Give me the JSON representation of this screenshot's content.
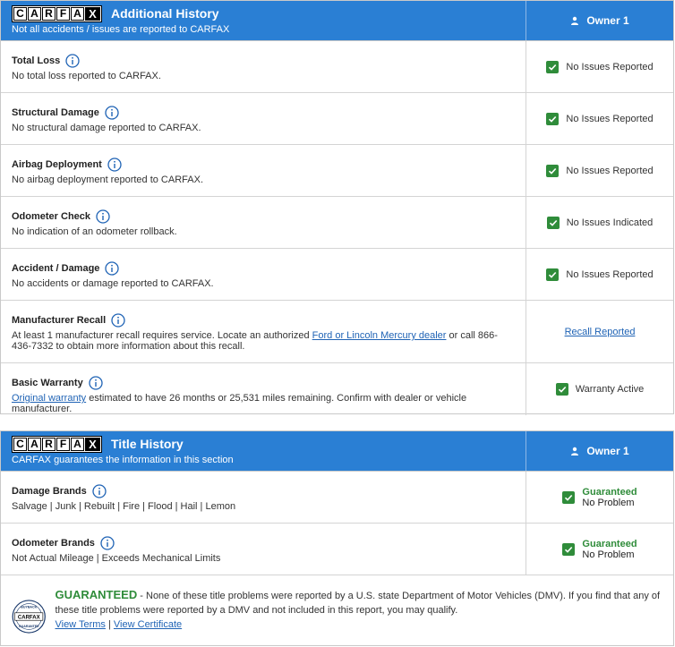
{
  "colors": {
    "header_bg": "#2a7fd4",
    "check_green": "#2f8c3a",
    "link_blue": "#1f63b5"
  },
  "logo_letters": [
    "C",
    "A",
    "R",
    "F",
    "A",
    "X"
  ],
  "additional_history": {
    "title": "Additional History",
    "subtitle": "Not all accidents / issues are reported to CARFAX",
    "owner_label": "Owner 1",
    "rows": [
      {
        "title": "Total Loss",
        "desc": "No total loss reported to CARFAX.",
        "status": "No Issues Reported"
      },
      {
        "title": "Structural Damage",
        "desc": "No structural damage reported to CARFAX.",
        "status": "No Issues Reported"
      },
      {
        "title": "Airbag Deployment",
        "desc": "No airbag deployment reported to CARFAX.",
        "status": "No Issues Reported"
      },
      {
        "title": "Odometer Check",
        "desc": "No indication of an odometer rollback.",
        "status": "No Issues Indicated"
      },
      {
        "title": "Accident / Damage",
        "desc": "No accidents or damage reported to CARFAX.",
        "status": "No Issues Reported"
      }
    ],
    "recall": {
      "title": "Manufacturer Recall",
      "desc_before": "At least 1 manufacturer recall requires service. Locate an authorized ",
      "desc_link": "Ford or Lincoln Mercury dealer",
      "desc_after": " or call 866-436-7332 to obtain more information about this recall.",
      "status_link": "Recall Reported"
    },
    "warranty": {
      "title": "Basic Warranty",
      "desc_link": "Original warranty",
      "desc_after": " estimated to have 26 months or 25,531 miles remaining. Confirm with dealer or vehicle manufacturer.",
      "status": "Warranty Active"
    }
  },
  "title_history": {
    "title": "Title History",
    "subtitle": "CARFAX guarantees the information in this section",
    "owner_label": "Owner 1",
    "rows": [
      {
        "title": "Damage Brands",
        "desc": "Salvage | Junk | Rebuilt | Fire | Flood | Hail | Lemon",
        "status_top": "Guaranteed",
        "status_bottom": "No Problem"
      },
      {
        "title": "Odometer Brands",
        "desc": "Not Actual Mileage | Exceeds Mechanical Limits",
        "status_top": "Guaranteed",
        "status_bottom": "No Problem"
      }
    ],
    "footer": {
      "guaranteed": "GUARANTEED",
      "text": " - None of these title problems were reported by a U.S. state Department of Motor Vehicles (DMV). If you find that any of these title problems were reported by a DMV and not included in this report, you may qualify.",
      "link_terms": "View Terms",
      "separator": " | ",
      "link_cert": "View Certificate",
      "seal_top": "BUYBACK",
      "seal_bottom": "GUARANTEE"
    }
  }
}
